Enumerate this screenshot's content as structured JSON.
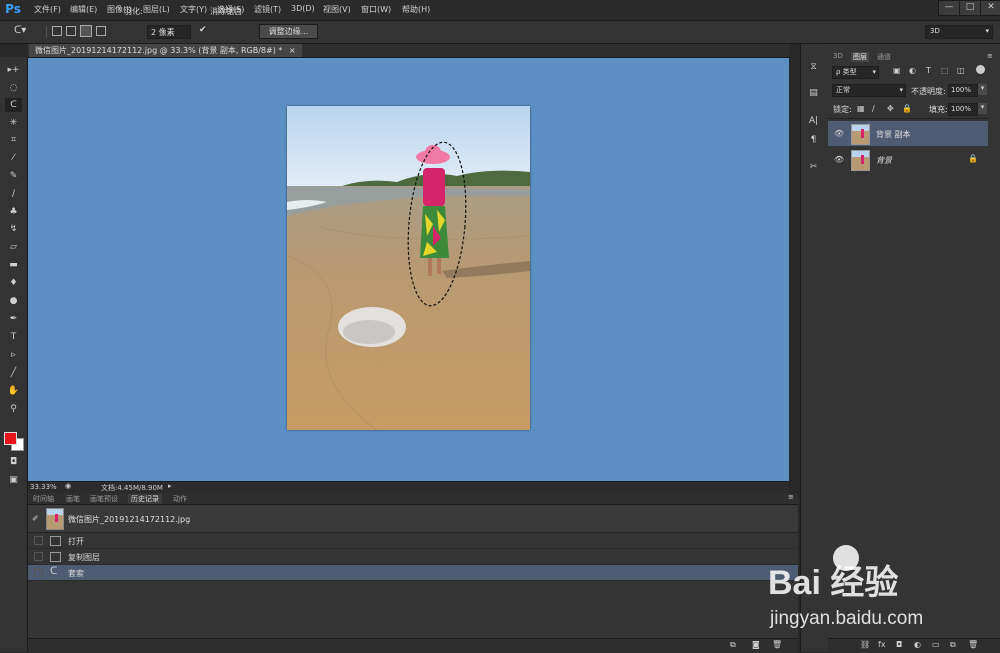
{
  "app": {
    "logo": "Ps",
    "menu": [
      "文件(F)",
      "编辑(E)",
      "图像(I)",
      "图层(L)",
      "文字(Y)",
      "选择(S)",
      "滤镜(T)",
      "3D(D)",
      "视图(V)",
      "窗口(W)",
      "帮助(H)"
    ],
    "window_buttons": [
      "—",
      "□",
      "✕"
    ]
  },
  "options": {
    "feather_label": "羽化:",
    "feather_value": "2 像素",
    "antialias_label": "消除锯齿",
    "refine_button": "调整边缘...",
    "workspace_value": "3D"
  },
  "document": {
    "tab_title": "微信图片_20191214172112.jpg @ 33.3% (背景 副本, RGB/8#) *",
    "tab_close": "×",
    "zoom": "33.33%",
    "doc_size": "文档:4.45M/8.90M"
  },
  "history": {
    "tabs": [
      "时间轴",
      "画笔",
      "画笔预设",
      "历史记录",
      "动作"
    ],
    "active_tab": 3,
    "snapshot_name": "微信图片_20191214172112.jpg",
    "items": [
      "打开",
      "复制图层",
      "套索"
    ],
    "selected_index": 2
  },
  "layers": {
    "tabs": [
      "3D",
      "图层",
      "通道"
    ],
    "active_tab": 1,
    "filter_label": "ρ 类型",
    "blend_mode": "正常",
    "opacity_label": "不透明度:",
    "opacity_value": "100%",
    "lock_label": "锁定:",
    "fill_label": "填充:",
    "fill_value": "100%",
    "items": [
      {
        "name": "背景 副本",
        "selected": true,
        "locked": false
      },
      {
        "name": "背景",
        "selected": false,
        "locked": true
      }
    ]
  },
  "watermark": {
    "brand": "Bai  经验",
    "url": "jingyan.baidu.com"
  },
  "colors": {
    "canvas_bg": "#5c8fc4",
    "foreground": "#e8141b",
    "background": "#ffffff",
    "selection_row": "#4d5b73"
  }
}
